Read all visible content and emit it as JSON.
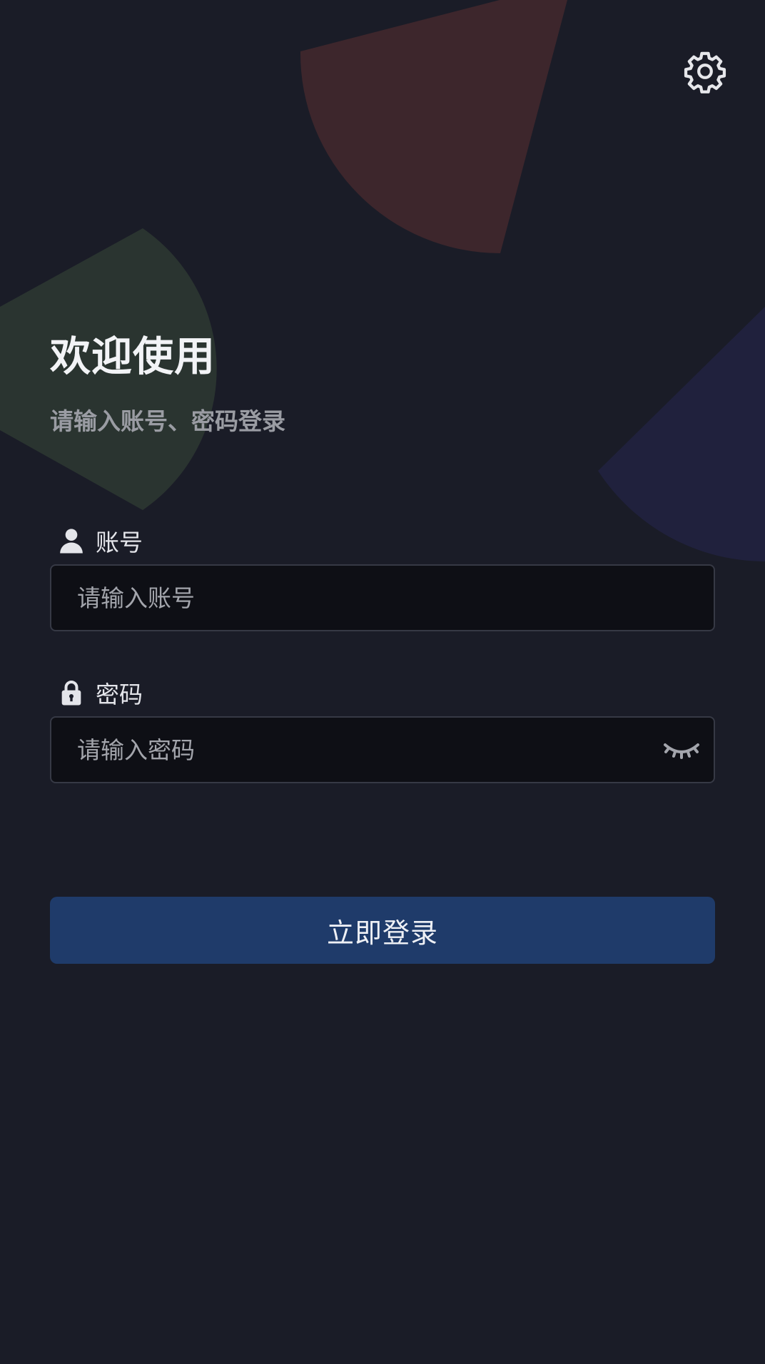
{
  "welcome": {
    "title": "欢迎使用",
    "subtitle": "请输入账号、密码登录"
  },
  "account": {
    "label": "账号",
    "placeholder": "请输入账号",
    "value": ""
  },
  "password": {
    "label": "密码",
    "placeholder": "请输入密码",
    "value": ""
  },
  "login_button": {
    "label": "立即登录"
  },
  "icons": {
    "settings": "gear-icon",
    "account": "user-icon",
    "password": "lock-icon",
    "visibility": "eye-closed-icon"
  },
  "colors": {
    "background": "#1a1c27",
    "primary_button": "#1f3b6a",
    "input_background": "#0e0f15",
    "input_border": "#363945",
    "title_text": "#f2f3f6",
    "subtitle_text": "#9a9ca3",
    "decor_red": "#3d262c",
    "decor_green": "#2a3430",
    "decor_blue": "#20213d"
  }
}
